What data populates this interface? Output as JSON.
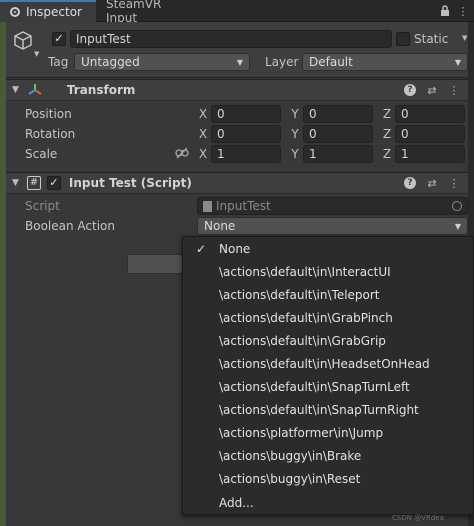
{
  "tabs": [
    {
      "label": "Inspector",
      "active": true
    },
    {
      "label": "SteamVR Input",
      "active": false
    }
  ],
  "header": {
    "object_name": "InputTest",
    "active_checked": true,
    "static_label": "Static",
    "tag_label": "Tag",
    "tag_value": "Untagged",
    "layer_label": "Layer",
    "layer_value": "Default"
  },
  "transform": {
    "title": "Transform",
    "rows": [
      {
        "label": "Position",
        "x": "0",
        "y": "0",
        "z": "0"
      },
      {
        "label": "Rotation",
        "x": "0",
        "y": "0",
        "z": "0"
      },
      {
        "label": "Scale",
        "x": "1",
        "y": "1",
        "z": "1"
      }
    ],
    "axis_x": "X",
    "axis_y": "Y",
    "axis_z": "Z"
  },
  "script_component": {
    "title": "Input Test (Script)",
    "script_label": "Script",
    "script_value": "InputTest",
    "boolean_label": "Boolean Action",
    "boolean_value": "None"
  },
  "popup": {
    "selected_index": 0,
    "items": [
      "None",
      "\\actions\\default\\in\\InteractUI",
      "\\actions\\default\\in\\Teleport",
      "\\actions\\default\\in\\GrabPinch",
      "\\actions\\default\\in\\GrabGrip",
      "\\actions\\default\\in\\HeadsetOnHead",
      "\\actions\\default\\in\\SnapTurnLeft",
      "\\actions\\default\\in\\SnapTurnRight",
      "\\actions\\platformer\\in\\Jump",
      "\\actions\\buggy\\in\\Brake",
      "\\actions\\buggy\\in\\Reset",
      "Add..."
    ]
  },
  "watermark": "CSDN @VRdea",
  "colors": {
    "accent": "#3a79bb",
    "panel": "#383838",
    "header": "#3e3e3e"
  }
}
